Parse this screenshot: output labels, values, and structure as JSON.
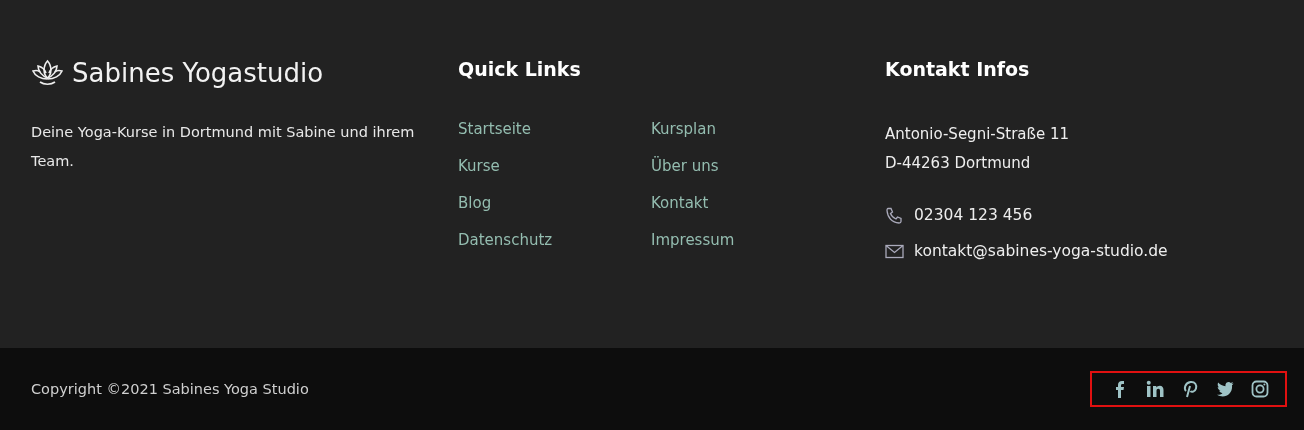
{
  "brand": {
    "title": "Sabines Yogastudio",
    "description": "Deine Yoga-Kurse in Dortmund mit Sabine und ihrem Team."
  },
  "quick_links": {
    "heading": "Quick Links",
    "links": [
      "Startseite",
      "Kurse",
      "Blog",
      "Datenschutz",
      "Kursplan",
      "Über uns",
      "Kontakt",
      "Impressum"
    ]
  },
  "contact": {
    "heading": "Kontakt Infos",
    "address_lines": [
      "Antonio-Segni-Straße 11",
      "D-44263 Dortmund"
    ],
    "phone": "02304 123 456",
    "email": "kontakt@sabines-yoga-studio.de"
  },
  "bottom_bar": {
    "copyright": "Copyright ©2021 Sabines Yoga Studio"
  }
}
